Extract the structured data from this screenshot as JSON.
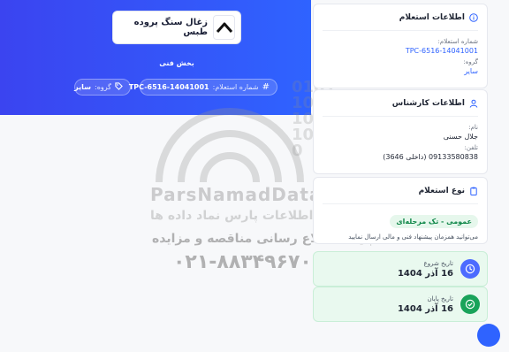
{
  "hero": {
    "company_name": "زغال سنگ پروده طبس",
    "subtitle": "بخش فنی",
    "ref_label": "شماره استعلام:",
    "ref_value": "TPC-6516-14041001",
    "group_label": "گروه:",
    "group_value": "سایر"
  },
  "info_card": {
    "title": "اطلاعات استعلام",
    "ref_label": "شماره استعلام:",
    "ref_value": "TPC-6516-14041001",
    "group_label": "گروه:",
    "group_value": "سایر"
  },
  "expert_card": {
    "title": "اطلاعات کارشناس",
    "name_label": "نام:",
    "name_value": "جلال حسنی",
    "phone_label": "تلفن:",
    "phone_value": "09133580838 (داخلی 3646)"
  },
  "type_card": {
    "title": "نوع استعلام",
    "badge": "عمومی - تک مرحله‌ای",
    "note": "می‌توانید همزمان پیشنهاد فنی و مالی ارسال نمایید"
  },
  "dates": {
    "start_label": "تاریخ شروع",
    "start_value": "16 آذر 1404",
    "end_label": "تاریخ پایان",
    "end_value": "16 آذر 1404"
  },
  "watermark": {
    "brand": "ParsNamadData",
    "center": "مرکز فن آوری اطلاعات پارس نماد داده ها",
    "base": "پایگاه اطلاع رسانی مناقصه و مزایده",
    "phone": "۰۲۱-۸۸۳۴۹۶۷۰-۵",
    "bits": "0101\n1001\n10\n10\n0"
  },
  "colors": {
    "hero": "#2f63ff",
    "accent": "#2f63ff",
    "success": "#19a35a"
  }
}
